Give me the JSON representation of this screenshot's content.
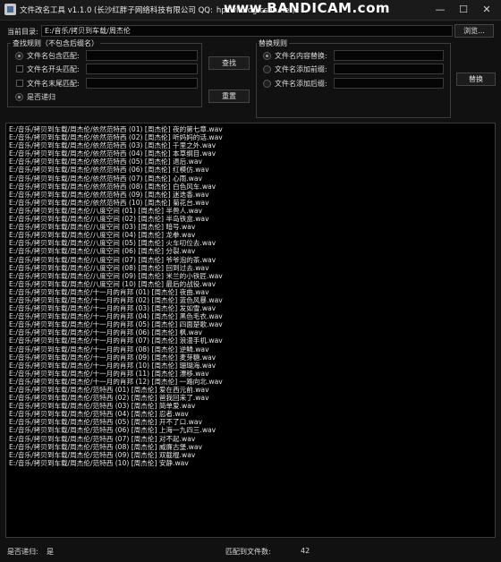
{
  "window": {
    "title": "文件改名工具 v1.1.0 (长沙红胖子网络科技有限公司 QQ:",
    "url_fragment": "hpzwl.blog.csdn.net)",
    "watermark": "www.BANDICAM.com",
    "min_symbol": "—",
    "max_symbol": "☐",
    "close_symbol": "✕"
  },
  "directory": {
    "label": "当前目录:",
    "value": "E:/音乐/拷贝到车载/周杰伦",
    "browse_label": "浏览..."
  },
  "find_group": {
    "title": "查找规则（不包含后缀名）",
    "rows": [
      {
        "label": "文件名包含匹配:",
        "value": ""
      },
      {
        "label": "文件名开头匹配:",
        "value": ""
      },
      {
        "label": "文件名末尾匹配:",
        "value": ""
      }
    ],
    "recursive_label": "是否递归",
    "find_button": "查找",
    "reset_button": "重置"
  },
  "replace_group": {
    "title": "替换规则",
    "rows": [
      {
        "label": "文件名内容替换:",
        "value": ""
      },
      {
        "label": "文件名添加前缀:",
        "value": ""
      },
      {
        "label": "文件名添加后缀:",
        "value": ""
      }
    ],
    "replace_button": "替换"
  },
  "files": [
    "E:/音乐/拷贝到车载/周杰伦/依然范特西 (01) [周杰伦] 夜的第七章.wav",
    "E:/音乐/拷贝到车载/周杰伦/依然范特西 (02) [周杰伦] 听妈妈的话.wav",
    "E:/音乐/拷贝到车载/周杰伦/依然范特西 (03) [周杰伦] 千里之外.wav",
    "E:/音乐/拷贝到车载/周杰伦/依然范特西 (04) [周杰伦] 本草纲目.wav",
    "E:/音乐/拷贝到车载/周杰伦/依然范特西 (05) [周杰伦] 退后.wav",
    "E:/音乐/拷贝到车载/周杰伦/依然范特西 (06) [周杰伦] 红模仿.wav",
    "E:/音乐/拷贝到车载/周杰伦/依然范特西 (07) [周杰伦] 心雨.wav",
    "E:/音乐/拷贝到车载/周杰伦/依然范特西 (08) [周杰伦] 白色风车.wav",
    "E:/音乐/拷贝到车载/周杰伦/依然范特西 (09) [周杰伦] 迷迭香.wav",
    "E:/音乐/拷贝到车载/周杰伦/依然范特西 (10) [周杰伦] 菊花台.wav",
    "E:/音乐/拷贝到车载/周杰伦/八度空间 (01) [周杰伦] 半兽人.wav",
    "E:/音乐/拷贝到车载/周杰伦/八度空间 (02) [周杰伦] 半岛铁盒.wav",
    "E:/音乐/拷贝到车载/周杰伦/八度空间 (03) [周杰伦] 暗号.wav",
    "E:/音乐/拷贝到车载/周杰伦/八度空间 (04) [周杰伦] 龙拳.wav",
    "E:/音乐/拷贝到车载/周杰伦/八度空间 (05) [周杰伦] 火车叨位去.wav",
    "E:/音乐/拷贝到车载/周杰伦/八度空间 (06) [周杰伦] 分裂.wav",
    "E:/音乐/拷贝到车载/周杰伦/八度空间 (07) [周杰伦] 爷爷泡的茶.wav",
    "E:/音乐/拷贝到车载/周杰伦/八度空间 (08) [周杰伦] 回到过去.wav",
    "E:/音乐/拷贝到车载/周杰伦/八度空间 (09) [周杰伦] 米兰的小铁匠.wav",
    "E:/音乐/拷贝到车载/周杰伦/八度空间 (10) [周杰伦] 最后的战役.wav",
    "E:/音乐/拷贝到车载/周杰伦/十一月的肖邦 (01) [周杰伦] 夜曲.wav",
    "E:/音乐/拷贝到车载/周杰伦/十一月的肖邦 (02) [周杰伦] 蓝色风暴.wav",
    "E:/音乐/拷贝到车载/周杰伦/十一月的肖邦 (03) [周杰伦] 发如雪.wav",
    "E:/音乐/拷贝到车载/周杰伦/十一月的肖邦 (04) [周杰伦] 黑色毛衣.wav",
    "E:/音乐/拷贝到车载/周杰伦/十一月的肖邦 (05) [周杰伦] 四面楚歌.wav",
    "E:/音乐/拷贝到车载/周杰伦/十一月的肖邦 (06) [周杰伦] 枫.wav",
    "E:/音乐/拷贝到车载/周杰伦/十一月的肖邦 (07) [周杰伦] 浪漫手机.wav",
    "E:/音乐/拷贝到车载/周杰伦/十一月的肖邦 (08) [周杰伦] 逆鳞.wav",
    "E:/音乐/拷贝到车载/周杰伦/十一月的肖邦 (09) [周杰伦] 麦芽糖.wav",
    "E:/音乐/拷贝到车载/周杰伦/十一月的肖邦 (10) [周杰伦] 珊瑚海.wav",
    "E:/音乐/拷贝到车载/周杰伦/十一月的肖邦 (11) [周杰伦] 漂移.wav",
    "E:/音乐/拷贝到车载/周杰伦/十一月的肖邦 (12) [周杰伦] 一路向北.wav",
    "E:/音乐/拷贝到车载/周杰伦/范特西 (01) [周杰伦] 爱在西元前.wav",
    "E:/音乐/拷贝到车载/周杰伦/范特西 (02) [周杰伦] 爸我回来了.wav",
    "E:/音乐/拷贝到车载/周杰伦/范特西 (03) [周杰伦] 简单爱.wav",
    "E:/音乐/拷贝到车载/周杰伦/范特西 (04) [周杰伦] 忍者.wav",
    "E:/音乐/拷贝到车载/周杰伦/范特西 (05) [周杰伦] 开不了口.wav",
    "E:/音乐/拷贝到车载/周杰伦/范特西 (06) [周杰伦] 上海一九四三.wav",
    "E:/音乐/拷贝到车载/周杰伦/范特西 (07) [周杰伦] 对不起.wav",
    "E:/音乐/拷贝到车载/周杰伦/范特西 (08) [周杰伦] 威廉古堡.wav",
    "E:/音乐/拷贝到车载/周杰伦/范特西 (09) [周杰伦] 双截棍.wav",
    "E:/音乐/拷贝到车载/周杰伦/范特西 (10) [周杰伦] 安静.wav"
  ],
  "status": {
    "recursive_label": "是否递归:",
    "recursive_value": "是",
    "match_label": "匹配到文件数:",
    "match_count": "42"
  }
}
